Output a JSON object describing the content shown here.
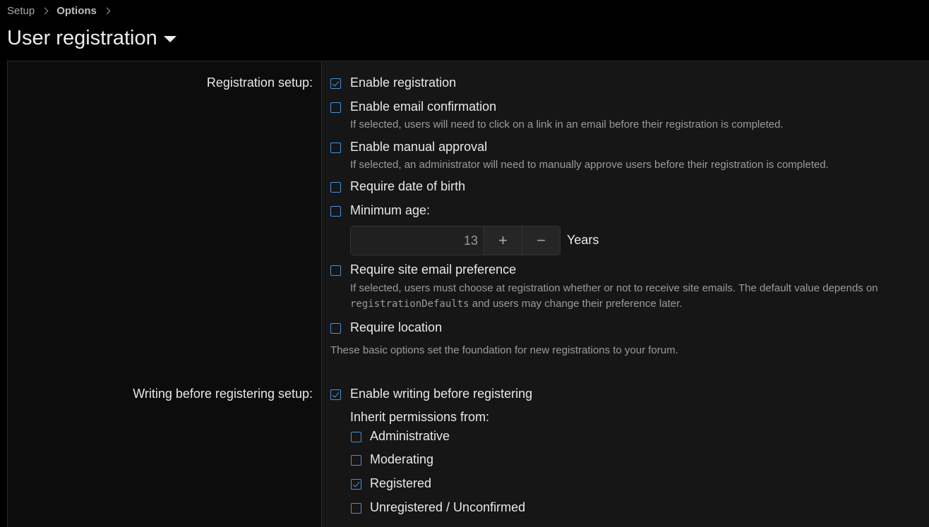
{
  "breadcrumb": {
    "items": [
      "Setup",
      "Options"
    ]
  },
  "page": {
    "title": "User registration"
  },
  "registration_setup": {
    "label": "Registration setup:",
    "options": [
      {
        "label": "Enable registration",
        "checked": true,
        "hint": ""
      },
      {
        "label": "Enable email confirmation",
        "checked": false,
        "hint": "If selected, users will need to click on a link in an email before their registration is completed."
      },
      {
        "label": "Enable manual approval",
        "checked": false,
        "hint": "If selected, an administrator will need to manually approve users before their registration is completed."
      },
      {
        "label": "Require date of birth",
        "checked": false,
        "hint": ""
      },
      {
        "label": "Minimum age:",
        "checked": false,
        "hint": ""
      },
      {
        "label": "Require site email preference",
        "checked": false,
        "hint": "If selected, users must choose at registration whether or not to receive site emails. The default value depends on"
      },
      {
        "label": "Require location",
        "checked": false,
        "hint": ""
      }
    ],
    "email_pref_hint_code": "registrationDefaults",
    "email_pref_hint_rest": "and users may change their preference later.",
    "min_age": {
      "value": "13",
      "plus": "+",
      "minus": "−",
      "unit": "Years"
    },
    "footer_hint": "These basic options set the foundation for new registrations to your forum."
  },
  "writing_setup": {
    "label": "Writing before registering setup:",
    "enable_label": "Enable writing before registering",
    "enable_checked": true,
    "inherit_label": "Inherit permissions from:",
    "groups": [
      {
        "label": "Administrative",
        "checked": false
      },
      {
        "label": "Moderating",
        "checked": false
      },
      {
        "label": "Registered",
        "checked": true
      },
      {
        "label": "Unregistered / Unconfirmed",
        "checked": false
      }
    ]
  },
  "colors": {
    "accent": "#4a8fd6",
    "background": "#000000",
    "panel": "#161616"
  }
}
